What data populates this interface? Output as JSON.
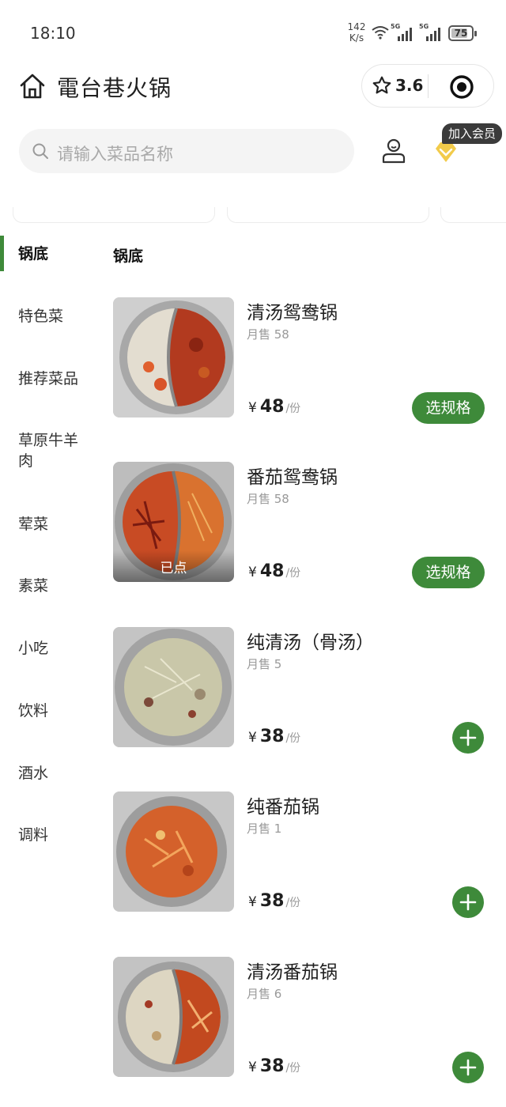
{
  "status_bar": {
    "time": "18:10",
    "net_speed_value": "142",
    "net_speed_unit": "K/s",
    "sim1_tag": "5G",
    "sim2_tag": "5G",
    "battery": "75"
  },
  "header": {
    "store_name": "電台巷火锅",
    "rating": "3.6"
  },
  "search": {
    "placeholder": "请输入菜品名称"
  },
  "member_badge": "加入会员",
  "sidebar": {
    "items": [
      {
        "label": "锅底",
        "active": true
      },
      {
        "label": "特色菜"
      },
      {
        "label": "推荐菜品"
      },
      {
        "label": "草原牛羊肉"
      },
      {
        "label": "荤菜"
      },
      {
        "label": "素菜"
      },
      {
        "label": "小吃"
      },
      {
        "label": "饮料"
      },
      {
        "label": "酒水"
      },
      {
        "label": "调料"
      }
    ]
  },
  "section_title": "锅底",
  "dishes": [
    {
      "name": "清汤鸳鸯锅",
      "sales": "月售 58",
      "currency": "¥",
      "price": "48",
      "unit": "/份",
      "action": "选规格"
    },
    {
      "name": "番茄鸳鸯锅",
      "sales": "月售 58",
      "currency": "¥",
      "price": "48",
      "unit": "/份",
      "action": "选规格",
      "tag": "已点"
    },
    {
      "name": "纯清汤（骨汤）",
      "sales": "月售 5",
      "currency": "¥",
      "price": "38",
      "unit": "/份",
      "action": "add"
    },
    {
      "name": "纯番茄锅",
      "sales": "月售 1",
      "currency": "¥",
      "price": "38",
      "unit": "/份",
      "action": "add"
    },
    {
      "name": "清汤番茄锅",
      "sales": "月售 6",
      "currency": "¥",
      "price": "38",
      "unit": "/份",
      "action": "add"
    }
  ],
  "colors": {
    "accent_green": "#3e8a3a",
    "vip_gold": "#f2cb4a",
    "badge_dark": "#3b3b3b"
  },
  "icons": [
    "home-icon",
    "star-icon",
    "target-icon",
    "search-icon",
    "user-icon",
    "vip-diamond-icon",
    "plus-icon",
    "wifi-icon",
    "signal-icon",
    "battery-icon"
  ]
}
